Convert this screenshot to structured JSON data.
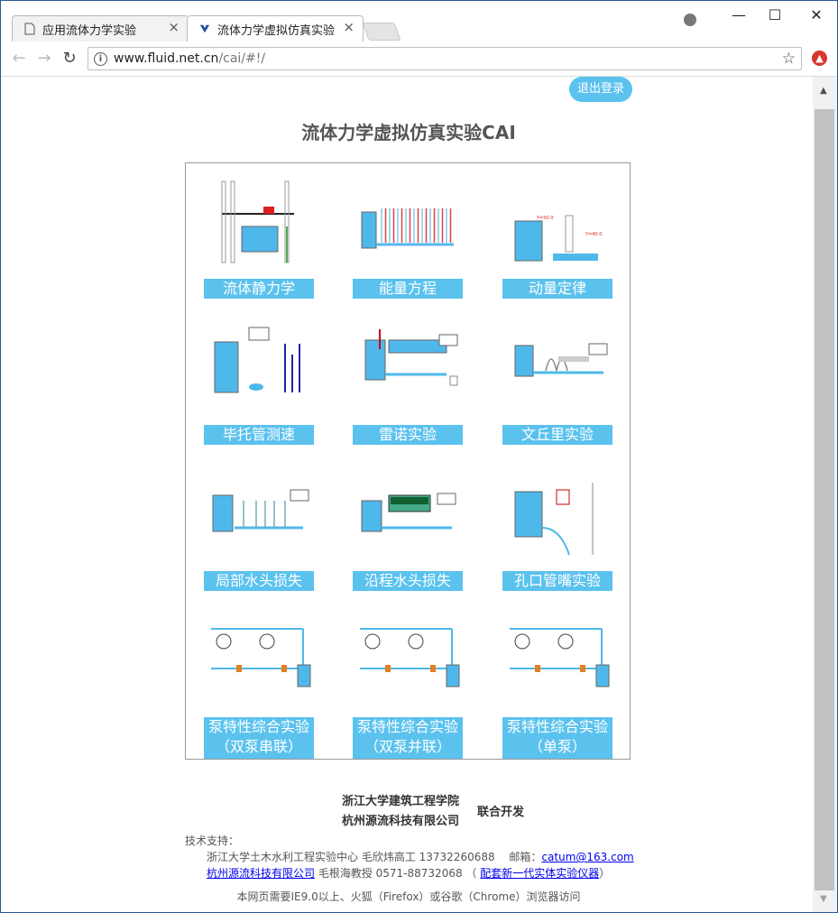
{
  "browser": {
    "tabs": [
      {
        "label": "应用流体力学实验"
      },
      {
        "label": "流体力学虚拟仿真实验CAI"
      }
    ],
    "url_host": "www.fluid.net.cn",
    "url_path": "/cai/#!/",
    "window_controls": {
      "minimize": "—",
      "maximize": "☐",
      "close": "✕"
    }
  },
  "page": {
    "logout_label": "退出登录",
    "title": "流体力学虚拟仿真实验CAI",
    "experiments": [
      {
        "label": "流体静力学",
        "thumb": "hydrostatics-icon"
      },
      {
        "label": "能量方程",
        "thumb": "energy-equation-icon"
      },
      {
        "label": "动量定律",
        "thumb": "momentum-law-icon"
      },
      {
        "label": "毕托管测速",
        "thumb": "pitot-tube-icon"
      },
      {
        "label": "雷诺实验",
        "thumb": "reynolds-icon"
      },
      {
        "label": "文丘里实验",
        "thumb": "venturi-icon"
      },
      {
        "label": "局部水头损失",
        "thumb": "local-head-loss-icon"
      },
      {
        "label": "沿程水头损失",
        "thumb": "friction-head-loss-icon"
      },
      {
        "label": "孔口管嘴实验",
        "thumb": "orifice-nozzle-icon"
      },
      {
        "label": "泵特性综合实验",
        "label2": "（双泵串联）",
        "thumb": "pump-series-icon"
      },
      {
        "label": "泵特性综合实验",
        "label2": "（双泵并联）",
        "thumb": "pump-parallel-icon"
      },
      {
        "label": "泵特性综合实验",
        "label2": "（单泵）",
        "thumb": "pump-single-icon"
      }
    ],
    "footer": {
      "org1": "浙江大学建筑工程学院",
      "org2": "杭州源流科技有限公司",
      "joint": "联合开发",
      "support_label": "技术支持：",
      "support1_text": "浙江大学土木水利工程实验中心 毛欣炜高工 13732260688　 邮箱：",
      "support1_email": "catum@163.com",
      "support2_company": "杭州源流科技有限公司",
      "support2_text": " 毛根海教授 0571-88732068 （ ",
      "support2_link": "配套新一代实体实验仪器",
      "support2_end": "）",
      "browser_note": "本网页需要IE9.0以上、火狐（Firefox）或谷歌（Chrome）浏览器访问"
    }
  },
  "colors": {
    "accent": "#5bc2ee",
    "water": "#4fb8ea"
  }
}
